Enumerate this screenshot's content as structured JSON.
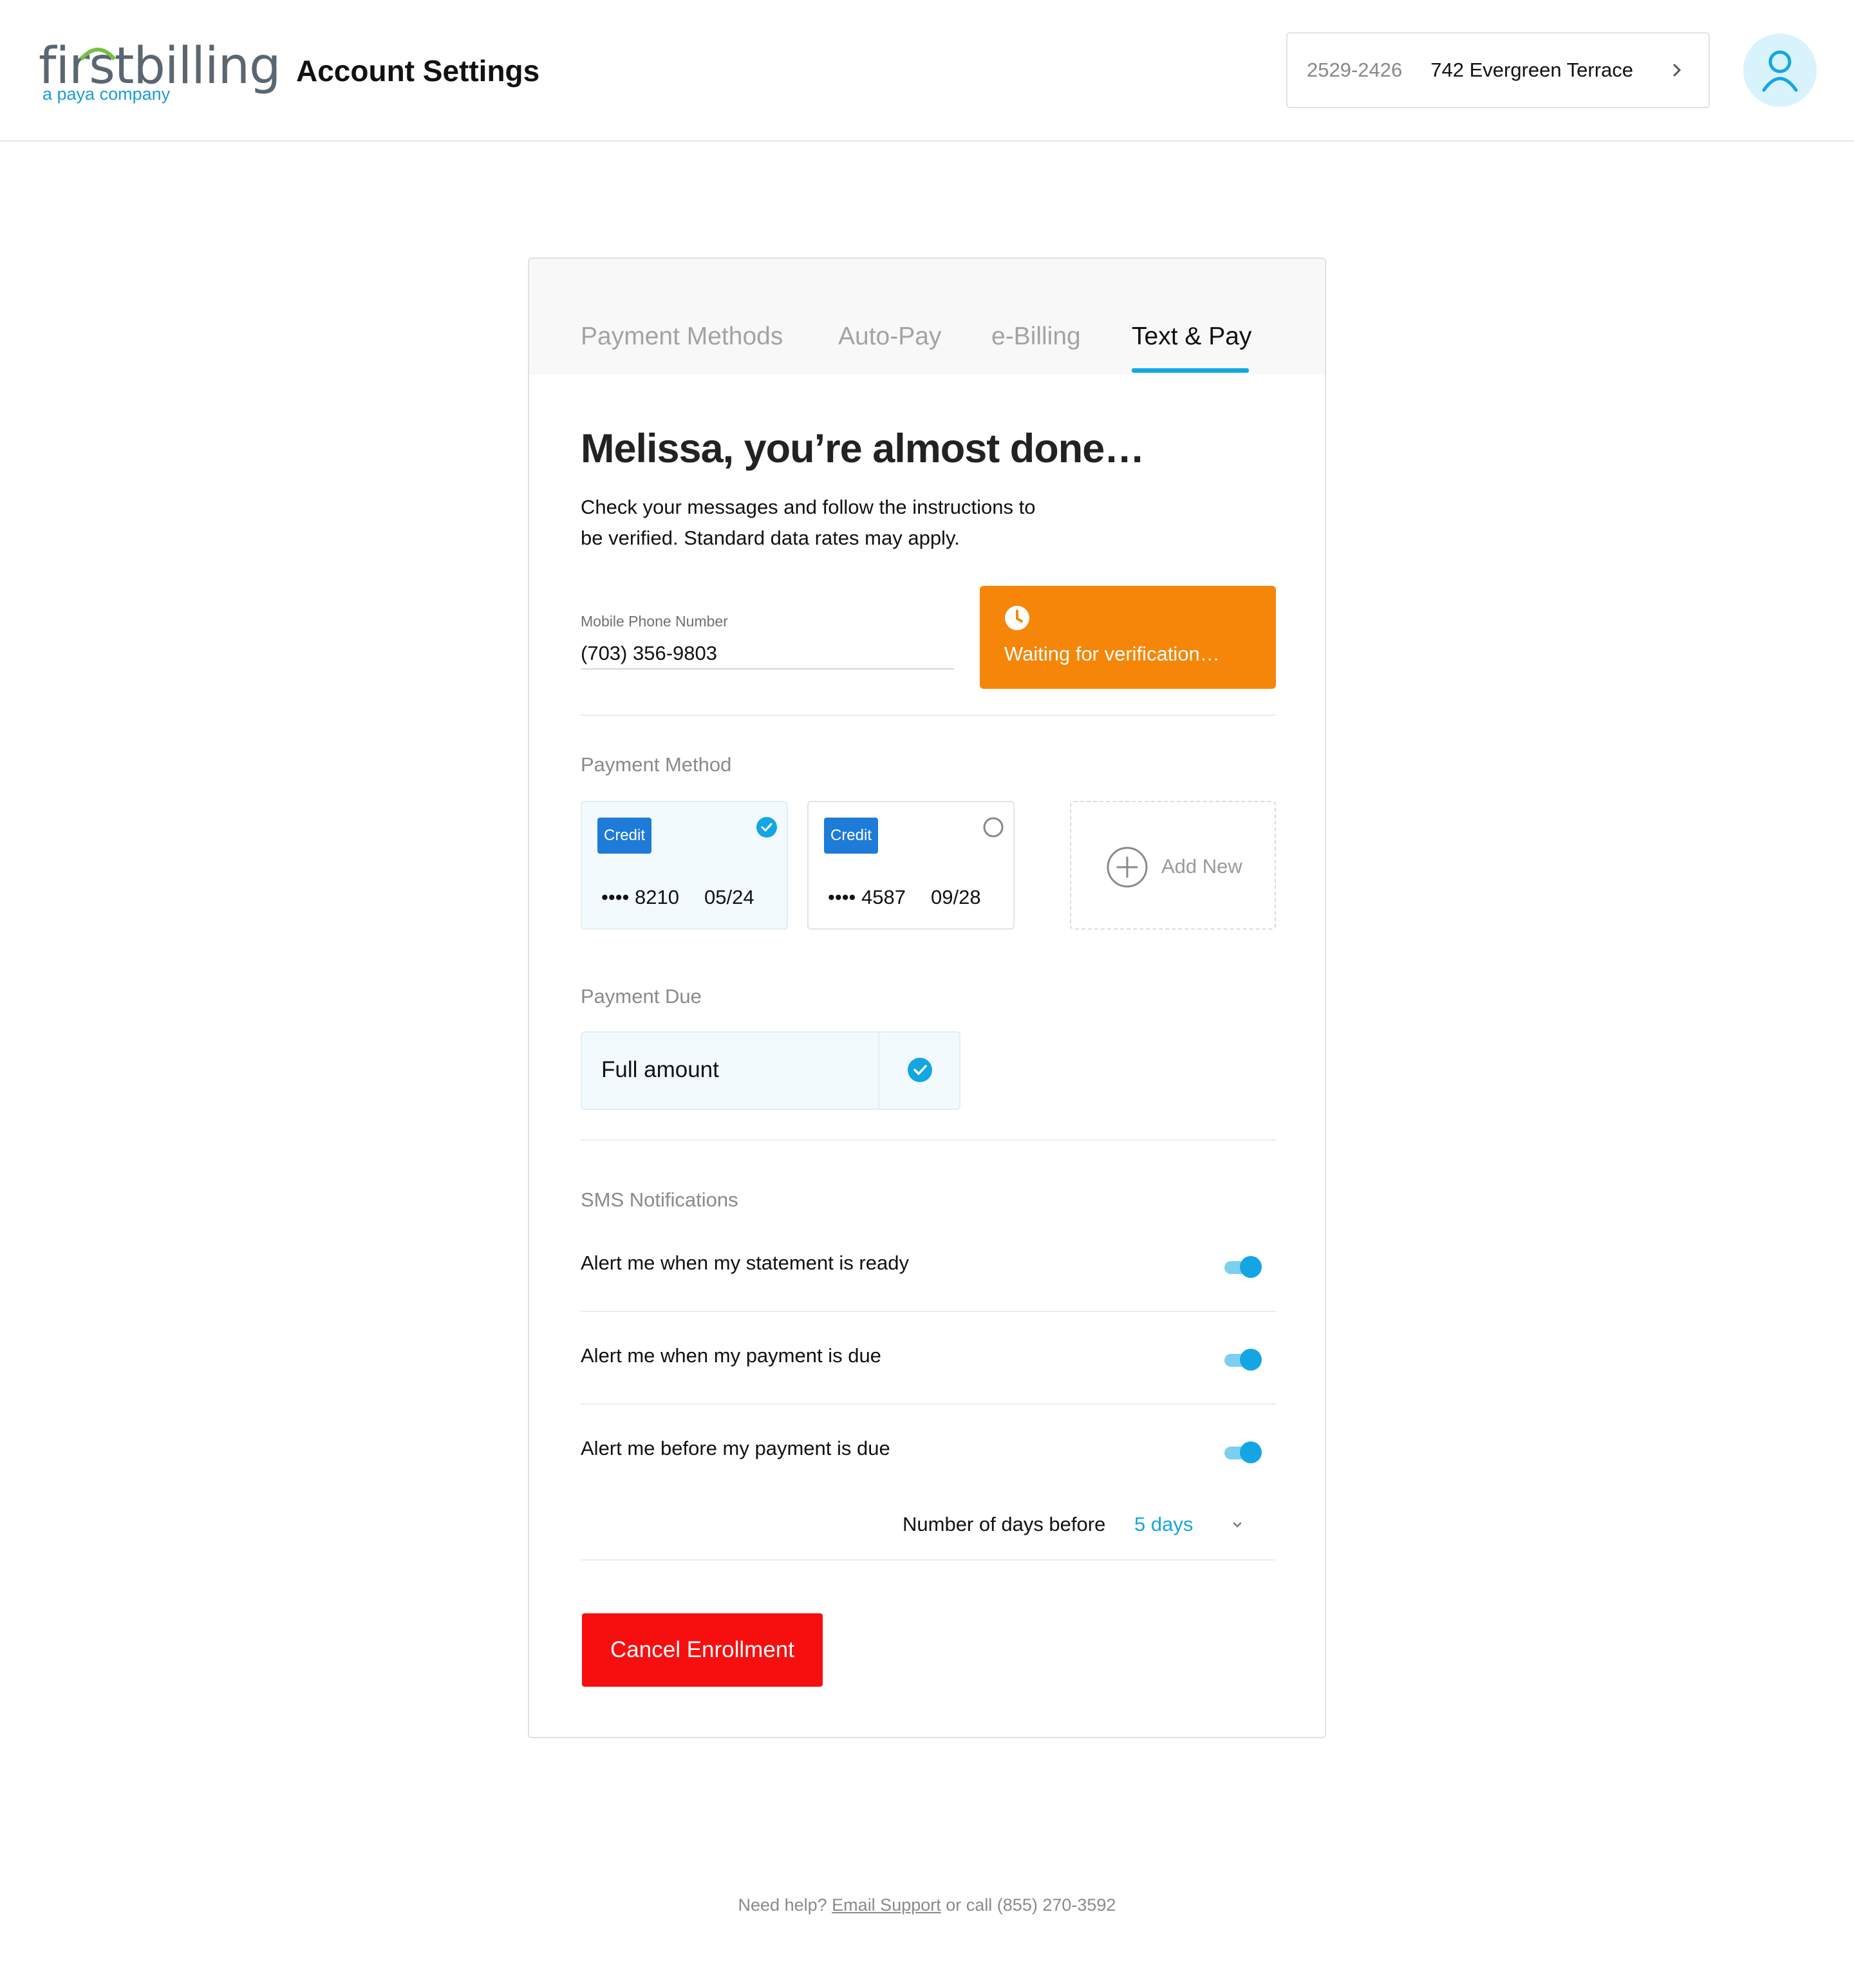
{
  "brand": {
    "logo_text": "first billing",
    "logo_word": "firstbilling",
    "tagline": "a paya company",
    "accent_color": "#13a6e3",
    "arc_color": "#77c043"
  },
  "header": {
    "title": "Account Settings",
    "account_number": "2529-2426",
    "account_address": "742 Evergreen Terrace",
    "chevron_icon": "chevron-right-icon",
    "avatar_icon": "user-icon"
  },
  "tabs": [
    {
      "label": "Payment Methods",
      "active": false
    },
    {
      "label": "Auto-Pay",
      "active": false
    },
    {
      "label": "e-Billing",
      "active": false
    },
    {
      "label": "Text & Pay",
      "active": true
    }
  ],
  "main": {
    "heading": "Melissa, you’re almost done…",
    "intro_line1": "Check your messages and follow the instructions to",
    "intro_line2": "be verified. Standard data rates may apply.",
    "phone_label": "Mobile Phone Number",
    "phone_value": "(703) 356-9803",
    "verification_status": "Waiting for verification…",
    "verification_color": "#f5860a"
  },
  "payment_method": {
    "section_label": "Payment Method",
    "cards": [
      {
        "type": "Credit",
        "last4": "•••• 8210",
        "expiry": "05/24",
        "selected": true
      },
      {
        "type": "Credit",
        "last4": "•••• 4587",
        "expiry": "09/28",
        "selected": false
      }
    ],
    "add_new_label": "Add New"
  },
  "payment_due": {
    "section_label": "Payment Due",
    "option": "Full amount",
    "selected": true
  },
  "sms": {
    "section_label": "SMS Notifications",
    "alerts": [
      {
        "label": "Alert me when my statement is ready",
        "enabled": true
      },
      {
        "label": "Alert me when my payment is due",
        "enabled": true
      },
      {
        "label": "Alert me before my payment is due",
        "enabled": true
      }
    ],
    "days_before_label": "Number of days before",
    "days_before_value": "5 days"
  },
  "actions": {
    "cancel_label": "Cancel Enrollment",
    "cancel_color": "#f70f0f"
  },
  "footer": {
    "prefix": "Need help?",
    "link": "Email Support",
    "suffix": "or call (855) 270-3592"
  }
}
